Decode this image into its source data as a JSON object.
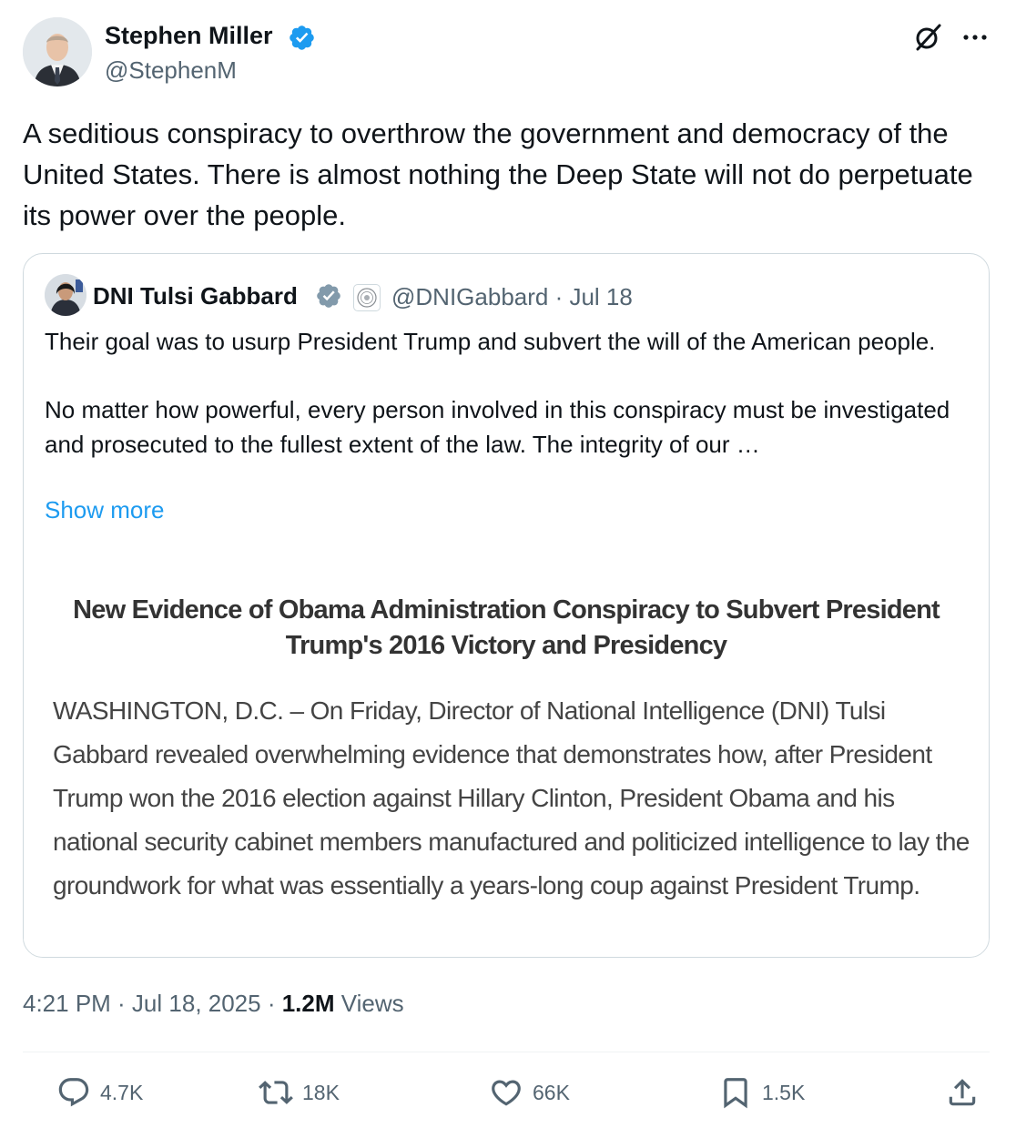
{
  "author": {
    "name": "Stephen Miller",
    "handle": "@StephenM"
  },
  "tweet": {
    "text": "A seditious conspiracy to overthrow the government and democracy of the United States. There is almost nothing the Deep State will not do perpetuate its power over the people."
  },
  "quote": {
    "name": "DNI Tulsi Gabbard",
    "meta": "@DNIGabbard · Jul 18",
    "paragraph1": "Their goal was to usurp President Trump and subvert the will of the American people.",
    "paragraph2": "No matter how powerful, every person involved in this conspiracy must be investigated and prosecuted to the fullest extent of the law. The integrity of our …",
    "show_more": "Show more",
    "image": {
      "title": "New Evidence of Obama Administration Conspiracy to Subvert President Trump's 2016 Victory and Presidency",
      "body": "WASHINGTON, D.C. – On Friday, Director of National Intelligence (DNI) Tulsi Gabbard revealed overwhelming evidence that demonstrates how, after President Trump won the 2016 election against Hillary Clinton, President Obama and his national security cabinet members manufactured and politicized intelligence to lay the groundwork for what was essentially a years-long coup against President Trump."
    }
  },
  "timestamp": {
    "time_date": "4:21 PM · Jul 18, 2025 · ",
    "views_count": "1.2M",
    "views_label": " Views"
  },
  "actions": {
    "replies": "4.7K",
    "reposts": "18K",
    "likes": "66K",
    "bookmarks": "1.5K"
  },
  "icons": {
    "verified": "verified-badge-icon",
    "grok": "grok-icon",
    "more": "more-icon",
    "reply": "reply-icon",
    "repost": "repost-icon",
    "like": "heart-icon",
    "bookmark": "bookmark-icon",
    "share": "share-icon"
  },
  "colors": {
    "accent": "#1d9bf0",
    "text": "#0f1419",
    "secondary": "#536471",
    "border": "#cfd9de",
    "verified_gray": "#829aab"
  }
}
